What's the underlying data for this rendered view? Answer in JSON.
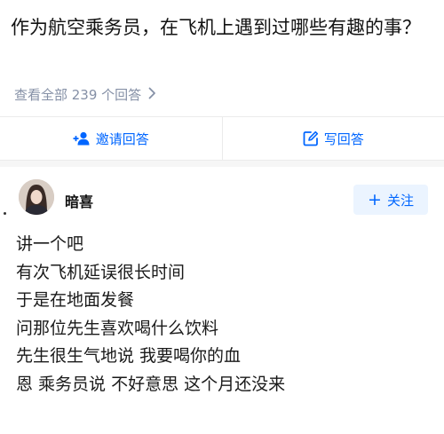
{
  "question": {
    "title": "作为航空乘务员，在飞机上遇到过哪些有趣的事？",
    "view_all": "查看全部 239 个回答"
  },
  "actions": {
    "invite_label": "邀请回答",
    "write_label": "写回答"
  },
  "answer": {
    "author": "暗喜",
    "follow_label": "关注",
    "lines": [
      "讲一个吧",
      "有次飞机延误很长时间",
      "于是在地面发餐",
      "问那位先生喜欢喝什么饮料",
      "先生很生气地说 我要喝你的血",
      "恩 乘务员说 不好意思 这个月还没来"
    ]
  },
  "colors": {
    "accent": "#0066ff",
    "follow_bg": "#ebf4ff",
    "muted": "#8590a6",
    "divider": "#ebebeb",
    "section_gap": "#f6f6f6"
  },
  "icons": {
    "invite": "add-user-icon",
    "write": "edit-icon",
    "view_all": "chevron-right-icon",
    "follow": "plus-icon"
  }
}
